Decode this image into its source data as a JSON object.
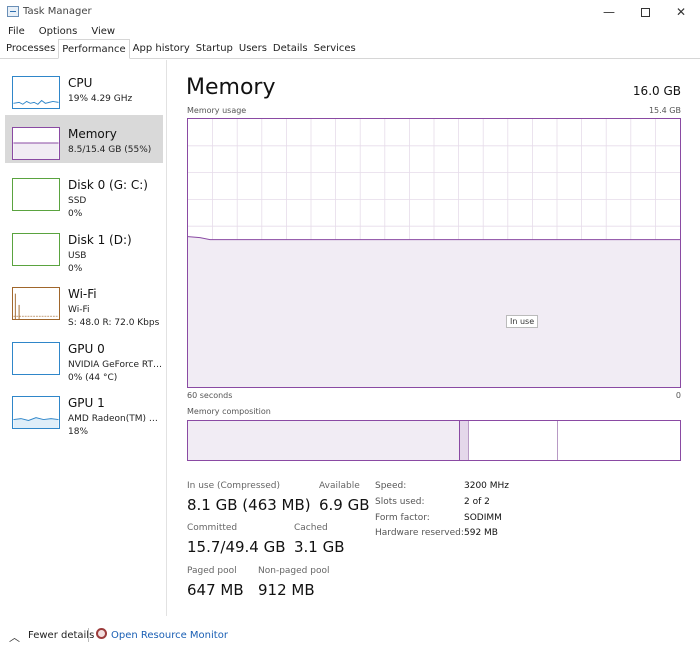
{
  "window": {
    "title": "Task Manager"
  },
  "menu": [
    "File",
    "Options",
    "View"
  ],
  "tabs": [
    "Processes",
    "Performance",
    "App history",
    "Startup",
    "Users",
    "Details",
    "Services"
  ],
  "active_tab": "Performance",
  "sidebar": [
    {
      "name": "CPU",
      "line1": "19%  4.29 GHz",
      "line2": "",
      "color": "#2f86c9"
    },
    {
      "name": "Memory",
      "line1": "8.5/15.4 GB (55%)",
      "line2": "",
      "color": "#8a4aa3"
    },
    {
      "name": "Disk 0 (G: C:)",
      "line1": "SSD",
      "line2": "0%",
      "color": "#5aa33f"
    },
    {
      "name": "Disk 1 (D:)",
      "line1": "USB",
      "line2": "0%",
      "color": "#5aa33f"
    },
    {
      "name": "Wi-Fi",
      "line1": "Wi-Fi",
      "line2": "S:  48.0  R:  72.0 Kbps",
      "color": "#a0662b"
    },
    {
      "name": "GPU 0",
      "line1": "NVIDIA GeForce RTX ...",
      "line2": "0%  (44 °C)",
      "color": "#2f86c9"
    },
    {
      "name": "GPU 1",
      "line1": "AMD Radeon(TM) Gra...",
      "line2": "18%",
      "color": "#2f86c9"
    }
  ],
  "main": {
    "title": "Memory",
    "total": "16.0 GB",
    "usage_label": "Memory usage",
    "usage_max": "15.4 GB",
    "axis_left": "60 seconds",
    "axis_right": "0",
    "tooltip": "In use",
    "composition_label": "Memory composition",
    "usage_level": 0.55,
    "composition": {
      "in_use": 0.55,
      "modified": 0.02,
      "standby": 0.18,
      "free": 0.25
    }
  },
  "stats": {
    "in_use_label": "In use (Compressed)",
    "in_use_value": "8.1 GB (463 MB)",
    "available_label": "Available",
    "available_value": "6.9 GB",
    "committed_label": "Committed",
    "committed_value": "15.7/49.4 GB",
    "cached_label": "Cached",
    "cached_value": "3.1 GB",
    "paged_label": "Paged pool",
    "paged_value": "647 MB",
    "nonpaged_label": "Non-paged pool",
    "nonpaged_value": "912 MB"
  },
  "details": {
    "speed_label": "Speed:",
    "speed_value": "3200 MHz",
    "slots_label": "Slots used:",
    "slots_value": "2 of 2",
    "form_label": "Form factor:",
    "form_value": "SODIMM",
    "reserved_label": "Hardware reserved:",
    "reserved_value": "592 MB"
  },
  "footer": {
    "fewer": "Fewer details",
    "resmon": "Open Resource Monitor"
  },
  "colors": {
    "memory": "#8a4aa3",
    "memory_fill": "#f1ecf4",
    "grid": "#e6dcea"
  }
}
